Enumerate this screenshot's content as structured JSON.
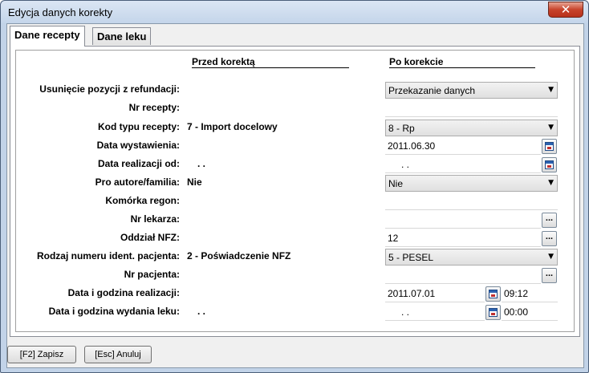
{
  "window": {
    "title": "Edycja danych korekty",
    "close_glyph": "✕"
  },
  "tabs": [
    {
      "label": "Dane recepty"
    },
    {
      "label": "Dane leku"
    }
  ],
  "headers": {
    "before": "Przed korektą",
    "after": "Po korekcie"
  },
  "rows": [
    {
      "label": "Usunięcie pozycji z refundacji:",
      "before": "",
      "after": "Przekazanie danych"
    },
    {
      "label": "Nr recepty:",
      "before": "",
      "after": ""
    },
    {
      "label": "Kod typu recepty:",
      "before": "7 - Import docelowy",
      "after": "8 - Rp"
    },
    {
      "label": "Data wystawienia:",
      "before": "",
      "after": "2011.06.30"
    },
    {
      "label": "Data realizacji od:",
      "before": ". .",
      "after": ". ."
    },
    {
      "label": "Pro autore/familia:",
      "before": "Nie",
      "after": "Nie"
    },
    {
      "label": "Komórka regon:",
      "before": "",
      "after": ""
    },
    {
      "label": "Nr lekarza:",
      "before": "",
      "after": ""
    },
    {
      "label": "Oddział NFZ:",
      "before": "",
      "after": "12"
    },
    {
      "label": "Rodzaj numeru ident. pacjenta:",
      "before": "2 - Poświadczenie NFZ",
      "after": "5 - PESEL"
    },
    {
      "label": "Nr pacjenta:",
      "before": "",
      "after": ""
    },
    {
      "label": "Data i godzina realizacji:",
      "before": "",
      "after": "2011.07.01",
      "time": "09:12"
    },
    {
      "label": "Data i godzina wydania leku:",
      "before": ". .",
      "after": ". .",
      "time": "00:00"
    }
  ],
  "buttons": {
    "save": "[F2] Zapisz",
    "cancel": "[Esc] Anuluj"
  },
  "glyphs": {
    "dropdown": "▼",
    "ellipsis": "..."
  },
  "icons": {
    "dropdown": "chevron-down-icon",
    "calendar": "calendar-icon",
    "ellipsis": "ellipsis-icon",
    "close": "close-icon"
  },
  "colors": {
    "window_frame": "#c2d3e8",
    "close_button": "#c7432b"
  }
}
